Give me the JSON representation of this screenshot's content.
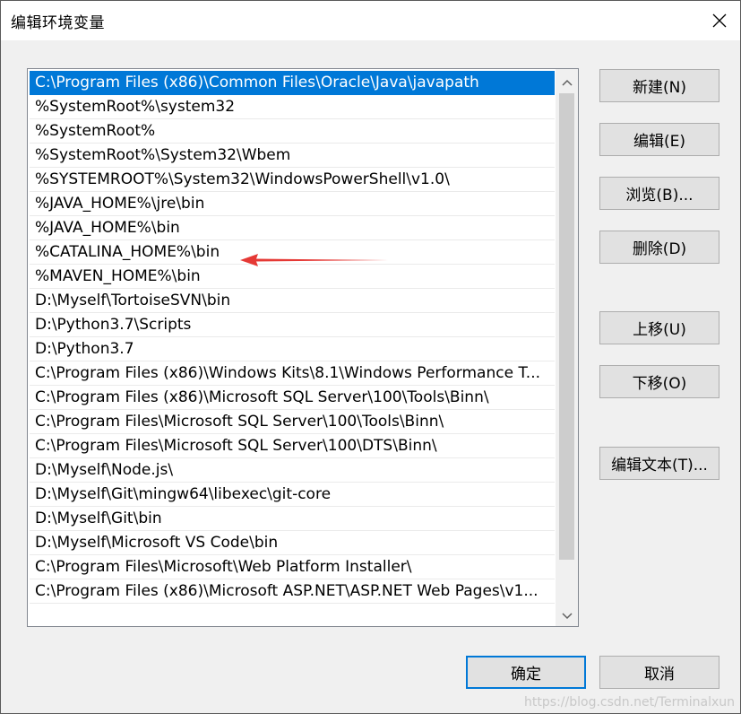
{
  "window": {
    "title": "编辑环境变量",
    "close_icon": "close-icon"
  },
  "paths": [
    "C:\\Program Files (x86)\\Common Files\\Oracle\\Java\\javapath",
    "%SystemRoot%\\system32",
    "%SystemRoot%",
    "%SystemRoot%\\System32\\Wbem",
    "%SYSTEMROOT%\\System32\\WindowsPowerShell\\v1.0\\",
    "%JAVA_HOME%\\jre\\bin",
    "%JAVA_HOME%\\bin",
    "%CATALINA_HOME%\\bin",
    "%MAVEN_HOME%\\bin",
    "D:\\Myself\\TortoiseSVN\\bin",
    "D:\\Python3.7\\Scripts",
    "D:\\Python3.7",
    "C:\\Program Files (x86)\\Windows Kits\\8.1\\Windows Performance T...",
    "C:\\Program Files (x86)\\Microsoft SQL Server\\100\\Tools\\Binn\\",
    "C:\\Program Files\\Microsoft SQL Server\\100\\Tools\\Binn\\",
    "C:\\Program Files\\Microsoft SQL Server\\100\\DTS\\Binn\\",
    "D:\\Myself\\Node.js\\",
    "D:\\Myself\\Git\\mingw64\\libexec\\git-core",
    "D:\\Myself\\Git\\bin",
    "D:\\Myself\\Microsoft VS Code\\bin",
    "C:\\Program Files\\Microsoft\\Web Platform Installer\\",
    "C:\\Program Files (x86)\\Microsoft ASP.NET\\ASP.NET Web Pages\\v1..."
  ],
  "selected_index": 0,
  "buttons": {
    "new": "新建(N)",
    "edit": "编辑(E)",
    "browse": "浏览(B)...",
    "delete": "删除(D)",
    "move_up": "上移(U)",
    "move_down": "下移(O)",
    "edit_text": "编辑文本(T)...",
    "ok": "确定",
    "cancel": "取消"
  },
  "watermark": "https://blog.csdn.net/Terminalxun",
  "colors": {
    "selection": "#0078d7",
    "annotation_arrow": "#e53935"
  }
}
